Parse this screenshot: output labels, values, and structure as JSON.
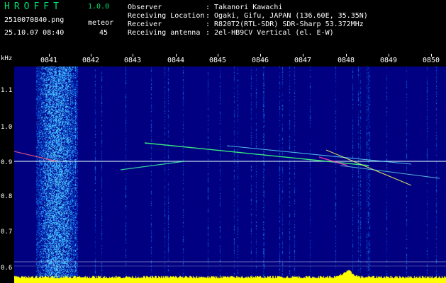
{
  "app": {
    "title": "HROFFT",
    "version": "1.0.0"
  },
  "file": {
    "name": "2510070840.png",
    "datetime": "25.10.07 08:40"
  },
  "meteor": {
    "label": "meteor",
    "count": "45"
  },
  "info": [
    {
      "label": "Observer",
      "value": ": Takanori Kawachi"
    },
    {
      "label": "Receiving Location",
      "value": ": Ogaki, Gifu, JAPAN (136.60E, 35.35N)"
    },
    {
      "label": "Receiver",
      "value": ": R820T2(RTL-SDR) SDR-Sharp 53.372MHz"
    },
    {
      "label": "Receiving antenna",
      "value": ": 2el-HB9CV Vertical (el. E-W)"
    }
  ],
  "yaxis": {
    "unit": "kHz",
    "ticks": [
      "1.1",
      "1.0",
      "0.9",
      "0.8",
      "0.7",
      "0.6"
    ]
  },
  "xaxis": {
    "ticks": [
      "0841",
      "0842",
      "0843",
      "0844",
      "0845",
      "0846",
      "0847",
      "0848",
      "0849",
      "0850"
    ]
  },
  "colors": {
    "background": "#000080",
    "signal": "#00e0ff",
    "strong": "#ffff00",
    "title": "#00e070"
  }
}
